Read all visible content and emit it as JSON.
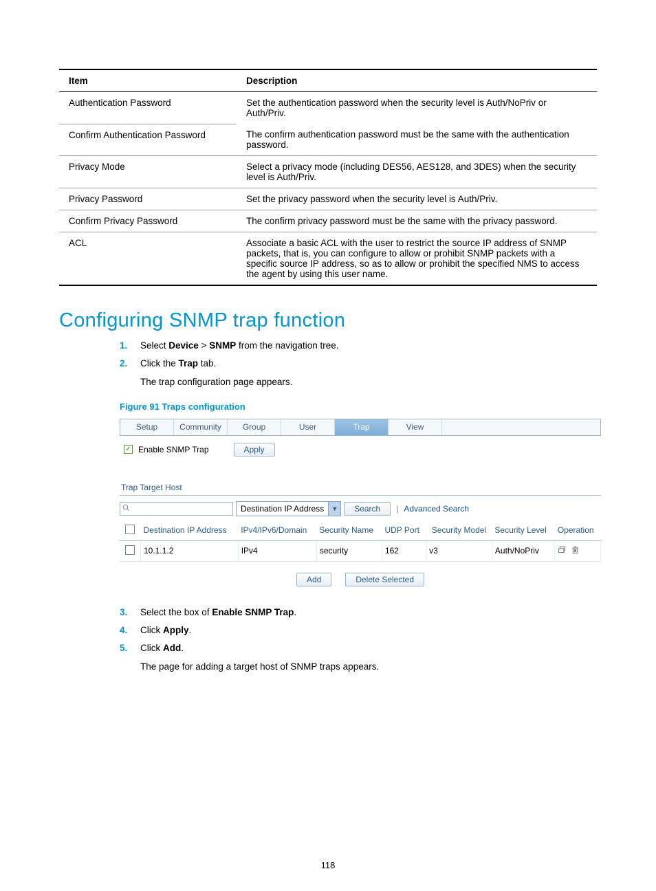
{
  "param_table": {
    "headers": {
      "item": "Item",
      "desc": "Description"
    },
    "rows": [
      {
        "item": "Authentication Password",
        "desc_a": "Set the authentication password when the security level is Auth/NoPriv or Auth/Priv.",
        "rowspan_desc": true
      },
      {
        "item": "Confirm Authentication Password",
        "desc_a": "The confirm authentication password must be the same with the authentication password.",
        "sub": true
      },
      {
        "item": "Privacy Mode",
        "desc_a": "Select a privacy mode (including DES56, AES128, and 3DES) when the security level is Auth/Priv."
      },
      {
        "item": "Privacy Password",
        "desc_a": "Set the privacy password when the security level is Auth/Priv."
      },
      {
        "item": "Confirm Privacy Password",
        "desc_a": "The confirm privacy password must be the same with the privacy password."
      },
      {
        "item": "ACL",
        "desc_a": "Associate a basic ACL with the user to restrict the source IP address of SNMP packets, that is, you can configure to allow or prohibit SNMP packets with a specific source IP address, so as to allow or prohibit the specified NMS to access the agent by using this user name.",
        "last": true
      }
    ]
  },
  "section_heading": "Configuring SNMP trap function",
  "steps1": [
    {
      "num": "1.",
      "pre": "Select ",
      "b1": "Device",
      "mid": " > ",
      "b2": "SNMP",
      "post": " from the navigation tree."
    },
    {
      "num": "2.",
      "pre": "Click the ",
      "b1": "Trap",
      "post": " tab."
    }
  ],
  "step2_sub": "The trap configuration page appears.",
  "figure_caption": "Figure 91 Traps configuration",
  "ui": {
    "tabs": [
      "Setup",
      "Community",
      "Group",
      "User",
      "Trap",
      "View"
    ],
    "active_tab": "Trap",
    "enable_label": "Enable SNMP Trap",
    "apply_label": "Apply",
    "section_label": "Trap Target Host",
    "search_select": "Destination IP Address",
    "search_btn": "Search",
    "adv_search": "Advanced Search",
    "columns": [
      "",
      "Destination IP Address",
      "IPv4/IPv6/Domain",
      "Security Name",
      "UDP Port",
      "Security Model",
      "Security Level",
      "Operation"
    ],
    "row": {
      "ip": "10.1.1.2",
      "dom": "IPv4",
      "sec": "security",
      "port": "162",
      "model": "v3",
      "level": "Auth/NoPriv"
    },
    "add_btn": "Add",
    "del_btn": "Delete Selected"
  },
  "steps2": [
    {
      "num": "3.",
      "pre": "Select the box of ",
      "b1": "Enable SNMP Trap",
      "post": "."
    },
    {
      "num": "4.",
      "pre": "Click ",
      "b1": "Apply",
      "post": "."
    },
    {
      "num": "5.",
      "pre": "Click ",
      "b1": "Add",
      "post": "."
    }
  ],
  "step5_sub": "The page for adding a target host of SNMP traps appears.",
  "page_number": "118"
}
